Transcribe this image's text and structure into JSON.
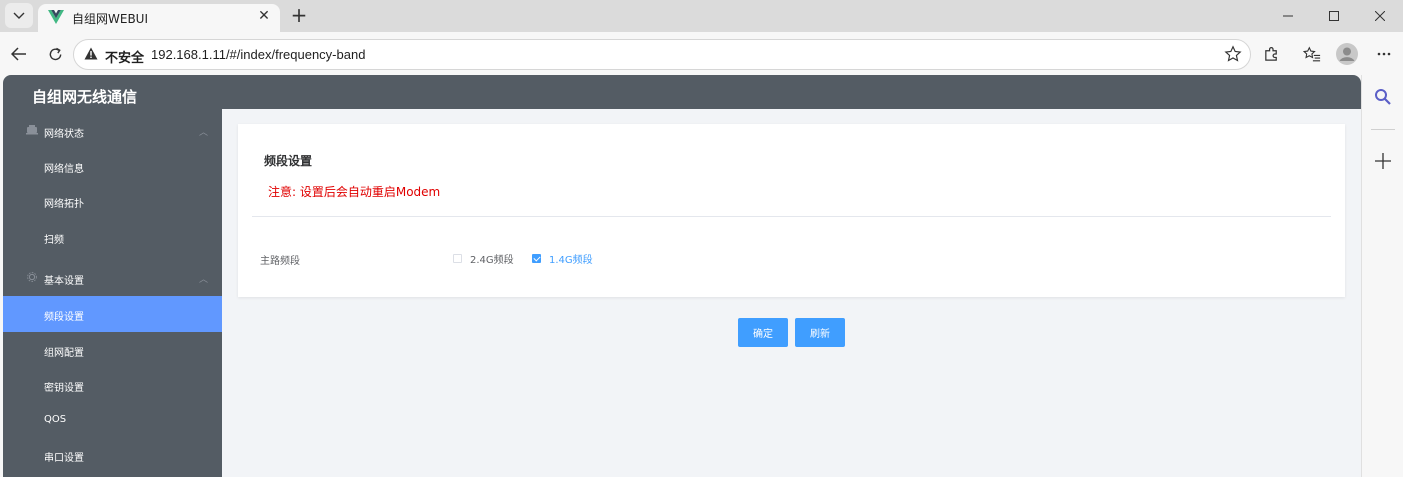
{
  "browser": {
    "tab_title": "自组网WEBUI",
    "insecure_label": "不安全",
    "url": "192.168.1.11/#/index/frequency-band",
    "colors": {
      "tab_strip": "#dbdbdb",
      "toolbar": "#f7f7f7"
    }
  },
  "app": {
    "title": "自组网无线通信",
    "colors": {
      "sidebar": "#545c64",
      "active": "#6198ff",
      "primary": "#409eff",
      "warning": "#e00000"
    }
  },
  "sidebar": {
    "groups": [
      {
        "label": "网络状态",
        "icon": "monitor-icon",
        "items": [
          {
            "label": "网络信息"
          },
          {
            "label": "网络拓扑"
          },
          {
            "label": "扫频"
          }
        ]
      },
      {
        "label": "基本设置",
        "icon": "gear-icon",
        "items": [
          {
            "label": "频段设置",
            "active": true
          },
          {
            "label": "组网配置"
          },
          {
            "label": "密钥设置"
          },
          {
            "label": "QOS"
          },
          {
            "label": "串口设置"
          }
        ]
      }
    ]
  },
  "main": {
    "card_title": "频段设置",
    "notice": "注意: 设置后会自动重启Modem",
    "form": {
      "label": "主路频段",
      "options": [
        {
          "label": "2.4G频段",
          "checked": false
        },
        {
          "label": "1.4G频段",
          "checked": true
        }
      ]
    },
    "buttons": {
      "confirm": "确定",
      "refresh": "刷新"
    }
  }
}
